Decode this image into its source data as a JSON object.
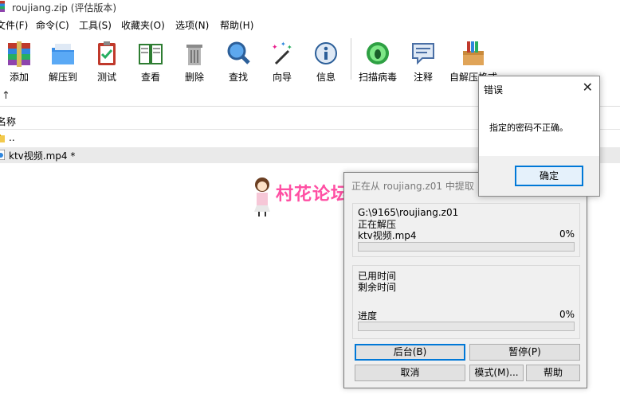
{
  "window": {
    "title": "roujiang.zip (评估版本)"
  },
  "menu": [
    "文件(F)",
    "命令(C)",
    "工具(S)",
    "收藏夹(O)",
    "选项(N)",
    "帮助(H)"
  ],
  "toolbar": [
    {
      "label": "添加",
      "icon": "add-archive-icon"
    },
    {
      "label": "解压到",
      "icon": "extract-to-icon"
    },
    {
      "label": "测试",
      "icon": "test-icon"
    },
    {
      "label": "查看",
      "icon": "view-icon"
    },
    {
      "label": "删除",
      "icon": "delete-icon"
    },
    {
      "label": "查找",
      "icon": "find-icon"
    },
    {
      "label": "向导",
      "icon": "wizard-icon"
    },
    {
      "label": "信息",
      "icon": "info-icon"
    },
    {
      "label": "扫描病毒",
      "icon": "virus-scan-icon"
    },
    {
      "label": "注释",
      "icon": "comment-icon"
    },
    {
      "label": "自解压格式",
      "icon": "sfx-icon"
    }
  ],
  "file_list": {
    "column_name": "名称",
    "rows": [
      {
        "name": "..",
        "icon": "folder-icon"
      },
      {
        "name": "ktv视频.mp4 *",
        "icon": "video-file-icon"
      }
    ]
  },
  "watermark": {
    "text": "村花论坛"
  },
  "progress_dialog": {
    "title": "正在从 roujiang.z01 中提取",
    "archive_path": "G:\\9165\\roujiang.z01",
    "action": "正在解压",
    "current_file": "ktv视频.mp4",
    "file_percent_label": "0%",
    "file_progress": 0,
    "elapsed_label": "已用时间",
    "remaining_label": "剩余时间",
    "progress_label": "进度",
    "total_percent_label": "0%",
    "total_progress": 0,
    "buttons": {
      "background": "后台(B)",
      "pause": "暂停(P)",
      "cancel": "取消",
      "mode": "模式(M)...",
      "help": "帮助"
    }
  },
  "error_dialog": {
    "title": "错误",
    "message": "指定的密码不正确。",
    "ok": "确定"
  },
  "colors": {
    "accent": "#0078d7",
    "watermark": "#ff4fa3",
    "progress": "#06b025"
  }
}
